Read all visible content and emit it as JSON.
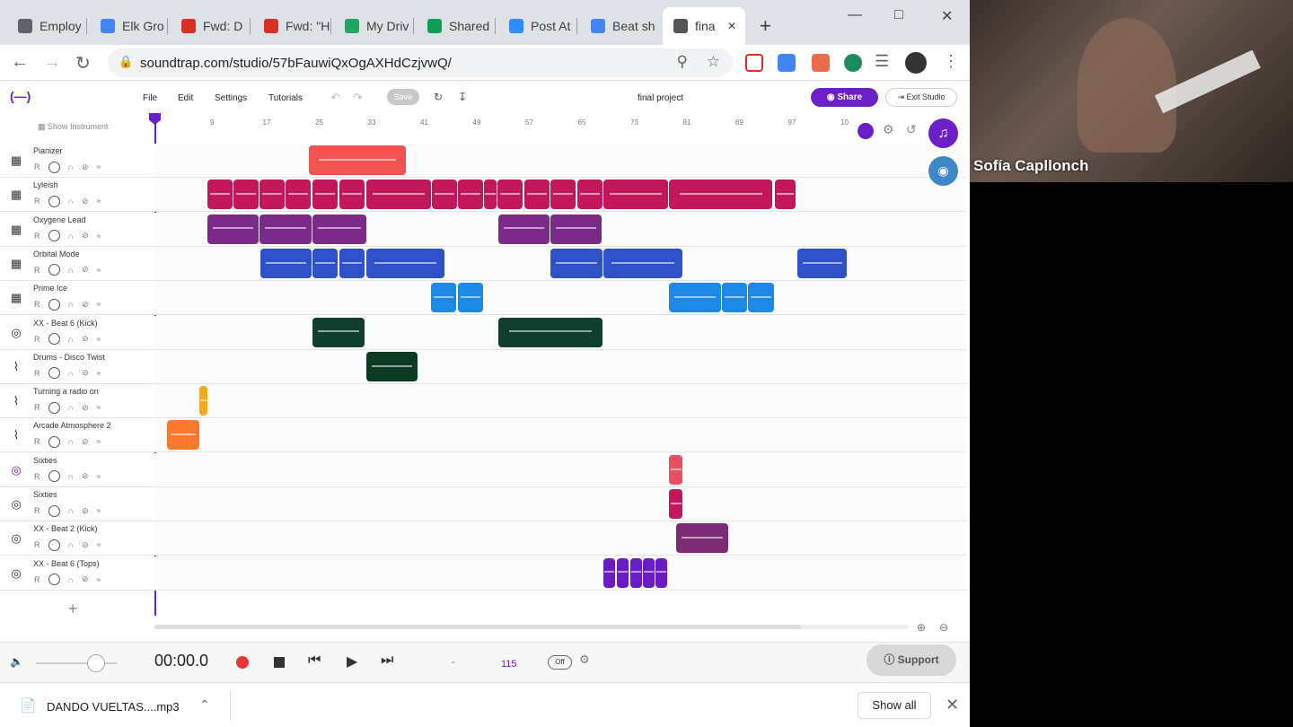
{
  "browser": {
    "tabs": [
      {
        "label": "Employ",
        "color": "#5f6368",
        "icon": "puzzle-icon"
      },
      {
        "label": "Elk Gro",
        "color": "#4285f4",
        "icon": "cloud-icon"
      },
      {
        "label": "Fwd: D",
        "color": "#d93025",
        "icon": "gmail-icon"
      },
      {
        "label": "Fwd: \"H",
        "color": "#d93025",
        "icon": "gmail-icon"
      },
      {
        "label": "My Driv",
        "color": "#1fa463",
        "icon": "drive-icon"
      },
      {
        "label": "Shared",
        "color": "#0f9d58",
        "icon": "sheets-icon"
      },
      {
        "label": "Post At",
        "color": "#2d8cff",
        "icon": "zoom-icon"
      },
      {
        "label": "Beat sh",
        "color": "#4285f4",
        "icon": "docs-icon"
      },
      {
        "label": "fina",
        "color": "#555555",
        "icon": "soundtrap-icon"
      }
    ],
    "url": "soundtrap.com/studio/57bFauwiQxOgAXHdCzjvwQ/"
  },
  "studio": {
    "menu": [
      "File",
      "Edit",
      "Settings",
      "Tutorials"
    ],
    "save_label": "Save",
    "project_title": "final project",
    "share_label": "Share",
    "exit_label": "Exit Studio",
    "show_instrument": "Show Instrument",
    "ruler": [
      "9",
      "17",
      "25",
      "33",
      "41",
      "49",
      "57",
      "65",
      "73",
      "81",
      "89",
      "97",
      "10"
    ],
    "track_button_r": "R",
    "tracks": [
      {
        "name": "Pianizer",
        "icon": "keyboard-icon"
      },
      {
        "name": "Lyleish",
        "icon": "keyboard-icon"
      },
      {
        "name": "Oxygene Lead",
        "icon": "keyboard-icon"
      },
      {
        "name": "Orbital Mode",
        "icon": "keyboard-icon"
      },
      {
        "name": "Prime Ice",
        "icon": "keyboard-icon"
      },
      {
        "name": "XX - Beat 6 (Kick)",
        "icon": "drum-icon"
      },
      {
        "name": "Drums - Disco Twist",
        "icon": "waveform-icon"
      },
      {
        "name": "Turning a radio on",
        "icon": "waveform-icon"
      },
      {
        "name": "Arcade Atmosphere 2",
        "icon": "waveform-icon"
      },
      {
        "name": "Sixties",
        "icon": "drum-icon"
      },
      {
        "name": "Sixties",
        "icon": "drum-icon"
      },
      {
        "name": "XX - Beat 2 (Kick)",
        "icon": "drum-icon"
      },
      {
        "name": "XX - Beat 6 (Tops)",
        "icon": "drum-icon"
      }
    ],
    "add_track": "+"
  },
  "transport": {
    "time": "00:00.0",
    "tempo_dash": "-",
    "tempo": "115",
    "metronome": "Off",
    "support_label": "Support"
  },
  "download": {
    "filename": "DANDO VUELTAS....mp3",
    "show_all": "Show all"
  },
  "video": {
    "participant": "Sofía Capllonch"
  },
  "colors": {
    "accent": "#6b1fc9",
    "pianizer": "#ef5350",
    "lyleish": "#c2185b",
    "oxygene": "#7b2a8a",
    "orbital": "#2e50c8",
    "prime": "#1e88e5",
    "kick": "#0f3d2e",
    "disco": "#0b3b24",
    "radio": "#f5a623",
    "arcade": "#ff7a2f",
    "sixties": "#e94f64",
    "sixties2": "#c2185b",
    "beat2": "#7b2a74",
    "tops": "#6a1cc4"
  }
}
